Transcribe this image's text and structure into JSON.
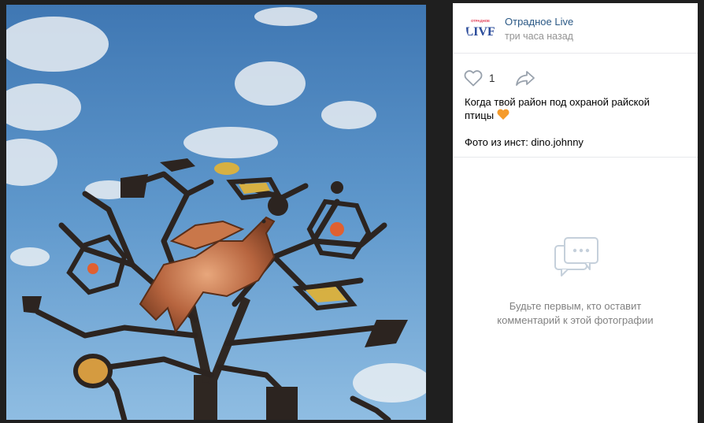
{
  "post": {
    "author_name": "Отрадное Live",
    "avatar_text_top": "ОТРАДНОЕ",
    "avatar_text_main": "LIVE",
    "time": "три часа назад",
    "likes": "1",
    "caption_line1": "Когда твой район под охраной райской",
    "caption_line2": "птицы",
    "caption_emoji": "orange-heart",
    "credit": "Фото из инст: dino.johnny"
  },
  "comments": {
    "empty_line1": "Будьте первым, кто оставит",
    "empty_line2": "комментарий к этой фотографии"
  },
  "icons": {
    "like": "heart-outline-icon",
    "share": "share-arrow-icon",
    "comments": "speech-bubble-icon"
  },
  "colors": {
    "link": "#2a5885",
    "muted": "#939393",
    "icon": "#99a2ad",
    "emoji": "#f59b2b",
    "avatar_red": "#e23a52",
    "avatar_blue": "#2b4c9b"
  }
}
